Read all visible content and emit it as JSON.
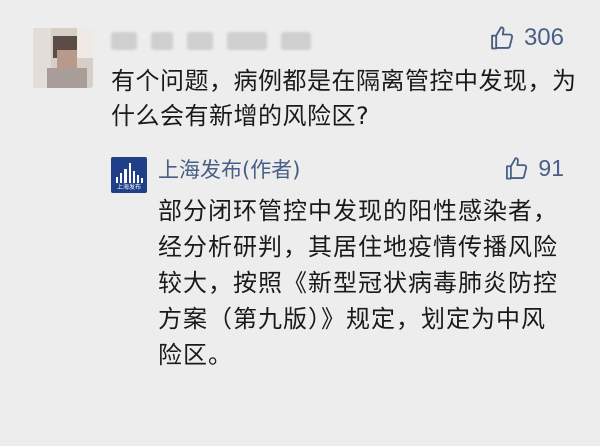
{
  "comment": {
    "like_count": "306",
    "text": "有个问题，病例都是在隔离管控中发现，为什么会有新增的风险区?"
  },
  "reply": {
    "logo_caption": "上海发布",
    "author": "上海发布(作者)",
    "like_count": "91",
    "text": "部分闭环管控中发现的阳性感染者，经分析研判，其居住地疫情传播风险较大，按照《新型冠状病毒肺炎防控方案（第九版）》规定，划定为中风险区。"
  },
  "colors": {
    "background": "#ededed",
    "link_blue": "#4a5f86",
    "logo_blue": "#1f3f88",
    "text": "#1a1a1a"
  },
  "icons": {
    "like": "thumbs-up-icon"
  }
}
